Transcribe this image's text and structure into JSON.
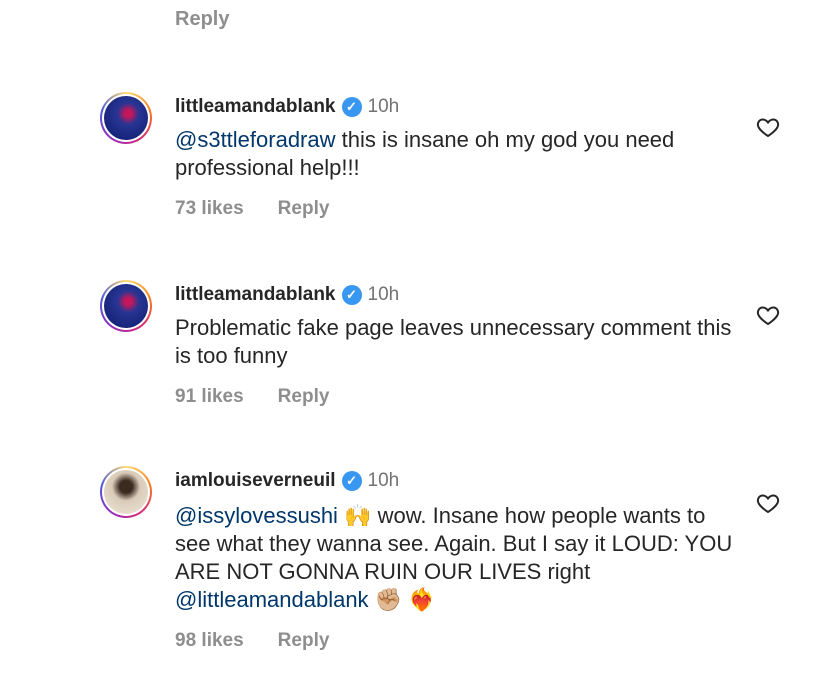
{
  "top_reply_label": "Reply",
  "comments": [
    {
      "username": "littleamandablank",
      "time": "10h",
      "mention": "@s3ttleforadraw",
      "text": " this is insane oh my god you need professional help!!!",
      "likes": "73 likes",
      "reply_label": "Reply"
    },
    {
      "username": "littleamandablank",
      "time": "10h",
      "text": "Problematic fake page leaves unnecessary comment this is too funny",
      "likes": "91 likes",
      "reply_label": "Reply"
    },
    {
      "username": "iamlouiseverneuil",
      "time": "10h",
      "mention": "@issylovessushi",
      "emoji1": "🙌",
      "text": " wow. Insane how people wants to see what they wanna see. Again. But I say it LOUD: YOU ARE NOT GONNA RUIN OUR LIVES  right ",
      "mention2": "@littleamandablank",
      "emoji2": "✊🏼 ❤️‍🔥",
      "likes": "98 likes",
      "reply_label": "Reply"
    }
  ],
  "icons": {
    "verified": "verified-badge-icon",
    "like": "heart-outline-icon"
  },
  "colors": {
    "verified": "#3897f0",
    "mention": "#00376b",
    "muted": "#8e8e8e"
  }
}
